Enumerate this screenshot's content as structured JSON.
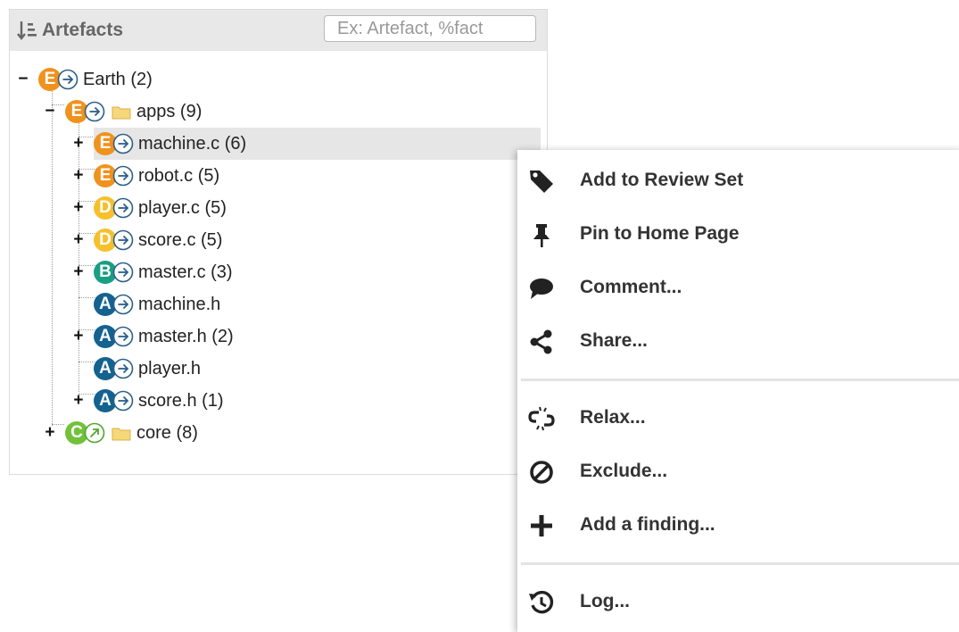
{
  "panel": {
    "title": "Artefacts",
    "search_placeholder": "Ex: Artefact, %fact"
  },
  "tree": [
    {
      "label": "Earth (2)",
      "grade": "E",
      "toggle": "−",
      "icon": "arrow-right-circle"
    },
    {
      "label": "apps (9)",
      "grade": "E",
      "toggle": "−",
      "icon": "arrow-right-circle",
      "folder": true
    },
    {
      "label": "machine.c (6)",
      "grade": "E",
      "toggle": "+",
      "icon": "arrow-right-circle",
      "selected": true
    },
    {
      "label": "robot.c (5)",
      "grade": "E",
      "toggle": "+",
      "icon": "arrow-right-circle"
    },
    {
      "label": "player.c (5)",
      "grade": "D",
      "toggle": "+",
      "icon": "arrow-right-circle"
    },
    {
      "label": "score.c (5)",
      "grade": "D",
      "toggle": "+",
      "icon": "arrow-right-circle"
    },
    {
      "label": "master.c (3)",
      "grade": "B",
      "toggle": "+",
      "icon": "arrow-right-circle"
    },
    {
      "label": "machine.h",
      "grade": "A",
      "toggle": "",
      "icon": "arrow-right-circle"
    },
    {
      "label": "master.h (2)",
      "grade": "A",
      "toggle": "+",
      "icon": "arrow-right-circle"
    },
    {
      "label": "player.h",
      "grade": "A",
      "toggle": "",
      "icon": "arrow-right-circle"
    },
    {
      "label": "score.h (1)",
      "grade": "A",
      "toggle": "+",
      "icon": "arrow-right-circle"
    },
    {
      "label": "core (8)",
      "grade": "C",
      "toggle": "+",
      "icon": "arrow-up-right-circle",
      "folder": true
    }
  ],
  "grade_colors": {
    "E": "#f0921e",
    "D": "#f6c02d",
    "B": "#1a9e84",
    "A": "#14628f",
    "C": "#72c13b"
  },
  "context_menu": {
    "items": [
      {
        "label": "Add to Review Set",
        "icon": "tag-icon"
      },
      {
        "label": "Pin to Home Page",
        "icon": "pin-icon"
      },
      {
        "label": "Comment...",
        "icon": "comment-icon"
      },
      {
        "label": "Share...",
        "icon": "share-icon"
      },
      {
        "label": "Relax...",
        "icon": "broken-link-icon"
      },
      {
        "label": "Exclude...",
        "icon": "ban-icon"
      },
      {
        "label": "Add a finding...",
        "icon": "plus-icon"
      },
      {
        "label": "Log...",
        "icon": "history-icon"
      }
    ]
  }
}
